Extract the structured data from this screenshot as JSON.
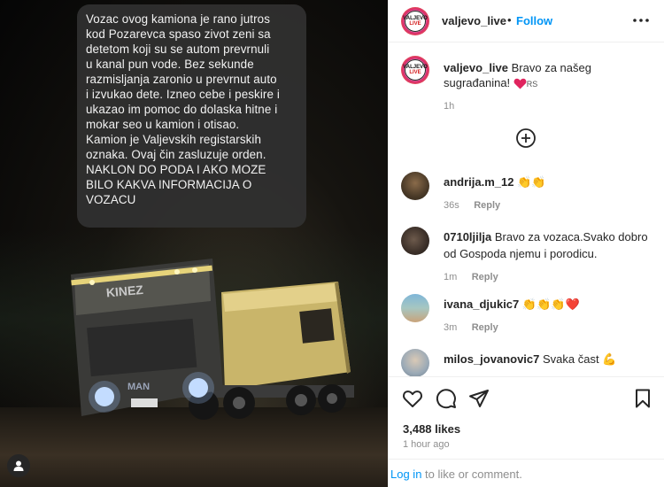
{
  "post": {
    "caption_lines": [
      "Vozac ovog kamiona je rano jutros",
      "kod Pozarevca spaso zivot zeni sa",
      "detetom koji su se autom prevrnuli",
      "u kanal pun vode. Bez sekunde",
      "razmisljanja zaronio u prevrnut auto",
      "i izvukao dete. Izneo cebe i peskire i",
      "ukazao im pomoc do dolaska hitne i",
      "mokar seo u kamion i otisao.",
      "Kamion je Valjevskih registarskih",
      "oznaka. Ovaj čin zasluzuje orden.",
      "NAKLON DO PODA I AKO MOZE",
      "BILO KAKVA INFORMACIJA O",
      "VOZACU"
    ],
    "truck_text": "KINEZ",
    "truck_brand": "MAN"
  },
  "header": {
    "username": "valjevo_live",
    "dot": "•",
    "follow_label": "Follow",
    "logo_top": "VALJEVO",
    "logo_bottom": "LIVE"
  },
  "caption_comment": {
    "username": "valjevo_live",
    "text": "Bravo za našeg sugrađanina!",
    "flag": "RS",
    "time": "1h"
  },
  "comments": [
    {
      "username": "andrija.m_12",
      "text": "",
      "emoji": "👏👏",
      "time": "36s",
      "reply": "Reply"
    },
    {
      "username": "0710ljilja",
      "text": "Bravo za vozaca.Svako dobro od Gospoda njemu i porodicu.",
      "emoji": "",
      "time": "1m",
      "reply": "Reply"
    },
    {
      "username": "ivana_djukic7",
      "text": "",
      "emoji": "👏👏👏❤️",
      "time": "3m",
      "reply": "Reply"
    },
    {
      "username": "milos_jovanovic7",
      "text": "Svaka čast",
      "emoji": "💪",
      "time": "",
      "reply": ""
    }
  ],
  "stats": {
    "likes": "3,488 likes",
    "ago": "1 hour ago"
  },
  "footer": {
    "login_link": "Log in",
    "rest": " to like or comment."
  },
  "icons": {
    "more": "more-icon",
    "like": "heart-icon",
    "comment": "comment-icon",
    "share": "share-icon",
    "save": "bookmark-icon",
    "load_more": "plus-circle-icon",
    "audio": "person-icon"
  },
  "colors": {
    "accent": "#0095f6",
    "muted": "#8e8e8e",
    "heart_red": "#ed4956"
  }
}
